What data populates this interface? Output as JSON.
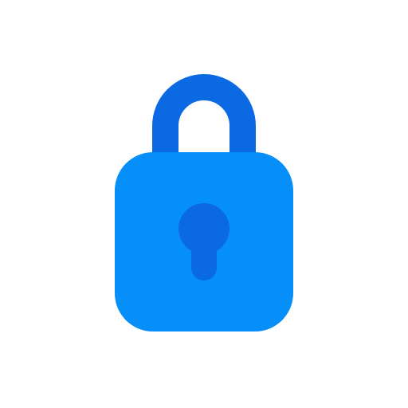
{
  "icon": {
    "name": "padlock-icon",
    "colors": {
      "background": "#ffffff",
      "shackle": "#0b69e3",
      "body": "#078ff9",
      "keyhole": "#0b69e3"
    }
  }
}
